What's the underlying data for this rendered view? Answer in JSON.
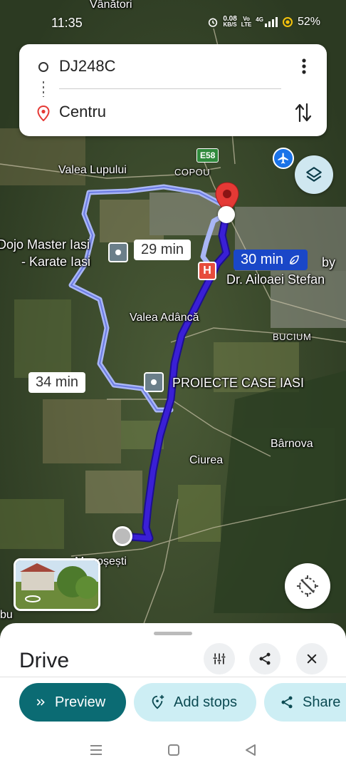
{
  "status_bar": {
    "time": "11:35",
    "net_speed": "0.08",
    "net_unit": "KB/S",
    "vo_top": "Vo",
    "vo_bottom": "LTE",
    "signal_type": "4G",
    "battery": "52%"
  },
  "route_card": {
    "origin": "DJ248C",
    "destination": "Centru"
  },
  "map": {
    "labels": {
      "vanatori": "Vânători",
      "valea_lupului": "Valea Lupului",
      "copou": "COPOU",
      "road_e58": "E58",
      "dojo_line1": "Dojo Master Iasi",
      "dojo_line2": "- Karate Iasi",
      "clinic_line1": "by",
      "clinic_line2": "Dr. Ailoaei Stefan",
      "valea_adanca": "Valea Adâncă",
      "bucium": "BUCIUM",
      "proiecte": "PROIECTE CASE IASI",
      "barnova": "Bârnova",
      "ciurea": "Ciurea",
      "mogosesti": "Mogoșești",
      "hlincea": "bu",
      "hospital": "H"
    },
    "time_bubbles": {
      "alt1": "29 min",
      "main": "30 min",
      "alt2": "34 min"
    }
  },
  "sheet": {
    "title": "Drive",
    "buttons": {
      "preview": "Preview",
      "add_stops": "Add stops",
      "share": "Share"
    }
  },
  "colors": {
    "main_route": "#3a1fd6",
    "alt_route": "#a9b6f5",
    "accent": "#0b6b73",
    "pin": "#e53935"
  }
}
